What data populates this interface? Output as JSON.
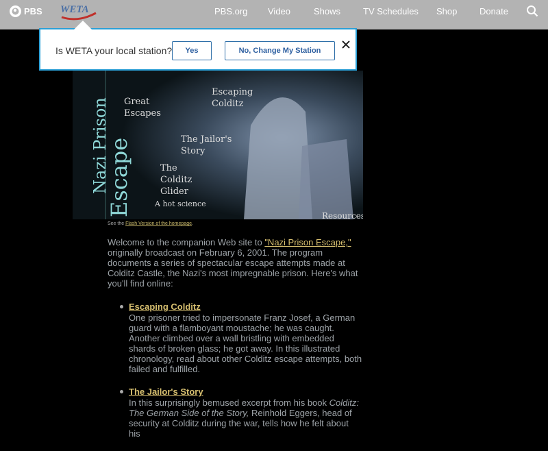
{
  "header": {
    "pbs_label": "PBS",
    "station_logo": "WETA",
    "nav": [
      "PBS.org",
      "Video",
      "Shows",
      "TV Schedules",
      "Shop",
      "Donate"
    ],
    "search_icon": "search-icon"
  },
  "popup": {
    "question": "Is WETA your local station?",
    "yes_label": "Yes",
    "no_label": "No, Change My Station",
    "close_icon": "close-icon"
  },
  "hero": {
    "title_line1": "Nazi Prison",
    "title_line2": "Escape",
    "great_escapes": "Great\nEscapes",
    "escaping_colditz": "Escaping\nColditz",
    "jailors_story": "The Jailor's\nStory",
    "colditz_glider": "The\nColditz\nGlider",
    "hot_science": "A hot science",
    "resources": "Resources"
  },
  "flash_note": {
    "prefix": "See the ",
    "link": "Flash Version of the homepage",
    "suffix": "."
  },
  "intro": {
    "before": "Welcome to the companion Web site to ",
    "link": "\"Nazi Prison Escape,\"",
    "after": " originally broadcast on February 6, 2001. The program documents a series of spectacular escape attempts made at Colditz Castle, the Nazi's most impregnable prison. Here's what you'll find online:"
  },
  "items": [
    {
      "title": "Escaping Colditz",
      "text": "One prisoner tried to impersonate Franz Josef, a German guard with a flamboyant moustache; he was caught. Another climbed over a wall bristling with embedded shards of broken glass; he got away. In this illustrated chronology, read about other Colditz escape attempts, both failed and fulfilled."
    },
    {
      "title": "The Jailor's Story",
      "text_before": "In this surprisingly bemused excerpt from his book ",
      "book": "Colditz: The German Side of the Story,",
      "text_after": " Reinhold Eggers, head of security at Colditz during the war, tells how he felt about his"
    }
  ]
}
